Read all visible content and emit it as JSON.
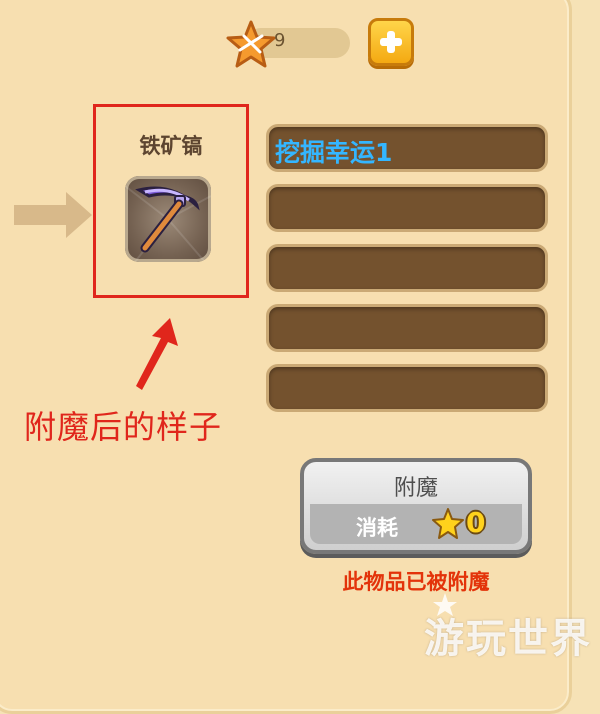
{
  "currency": {
    "icon": "star-icon",
    "count": "9"
  },
  "add_button": {
    "icon": "plus-icon"
  },
  "item": {
    "name": "铁矿镐",
    "icon": "pickaxe-icon"
  },
  "annotation": {
    "text": "附魔后的样子"
  },
  "enchant_slots": [
    "挖掘幸运1",
    "",
    "",
    "",
    ""
  ],
  "enchant_button": {
    "title": "附魔",
    "cost_label": "消耗",
    "cost_icon": "star-icon",
    "cost_value": "0"
  },
  "status": "此物品已被附魔",
  "watermark": "游玩世界",
  "colors": {
    "highlight": "#e0261c",
    "enchant_text": "#34b6ff",
    "status": "#e3330a",
    "slot_bg": "#74522e"
  }
}
